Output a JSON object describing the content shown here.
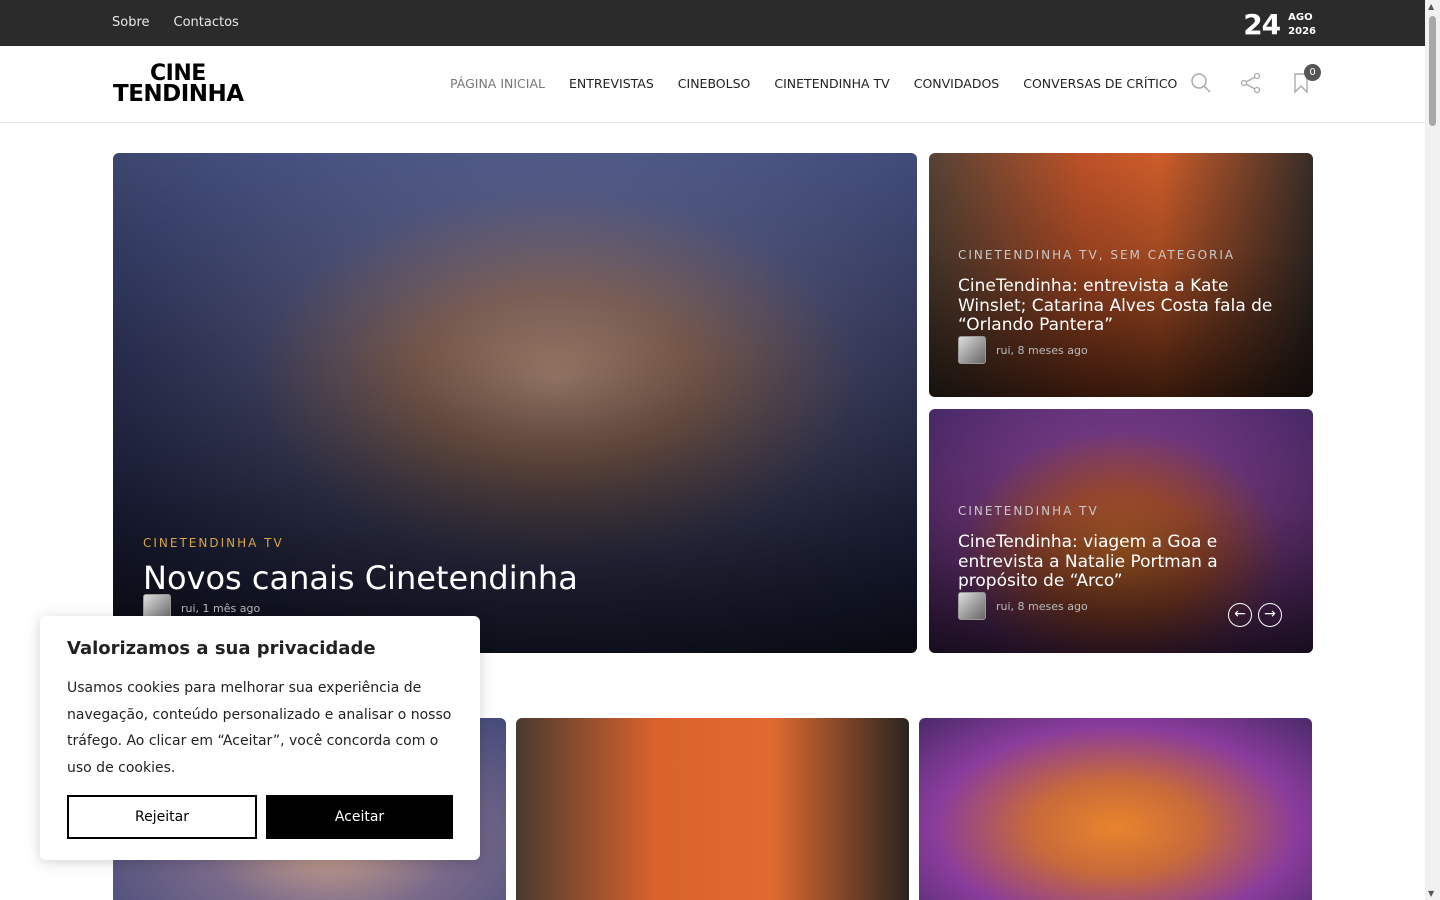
{
  "topbar": {
    "links": [
      "Sobre",
      "Contactos"
    ],
    "date_day": "24",
    "date_month": "AGO",
    "date_year": "2026"
  },
  "header": {
    "logo_line1": "CINE",
    "logo_line2": "TENDINHA",
    "nav": [
      "PÁGINA INICIAL",
      "ENTREVISTAS",
      "CINEBOLSO",
      "CINETENDINHA TV",
      "CONVIDADOS",
      "CONVERSAS DE CRÍTICO"
    ],
    "bookmark_count": "0"
  },
  "featured": {
    "main": {
      "category": "CINETENDINHA TV",
      "title": "Novos canais Cinetendinha",
      "meta": "rui, 1 mês ago"
    },
    "side": [
      {
        "category": "CINETENDINHA TV, SEM CATEGORIA",
        "title": "CineTendinha: entrevista a Kate Winslet; Catarina Alves Costa fala de “Orlando Pantera”",
        "meta": "rui, 8 meses ago"
      },
      {
        "category": "CINETENDINHA TV",
        "title": "CineTendinha: viagem a Goa e entrevista a Natalie Portman a propósito de “Arco”",
        "meta": "rui, 8 meses ago"
      }
    ]
  },
  "cookie": {
    "title": "Valorizamos a sua privacidade",
    "text": "Usamos cookies para melhorar sua experiência de navegação, conteúdo personalizado e analisar o nosso tráfego. Ao clicar em “Aceitar”, você concorda com o uso de cookies.",
    "reject": "Rejeitar",
    "accept": "Aceitar"
  },
  "colors": {
    "topbar": "#2b2b2b",
    "category": "#d9a441",
    "accent_black": "#000000"
  }
}
